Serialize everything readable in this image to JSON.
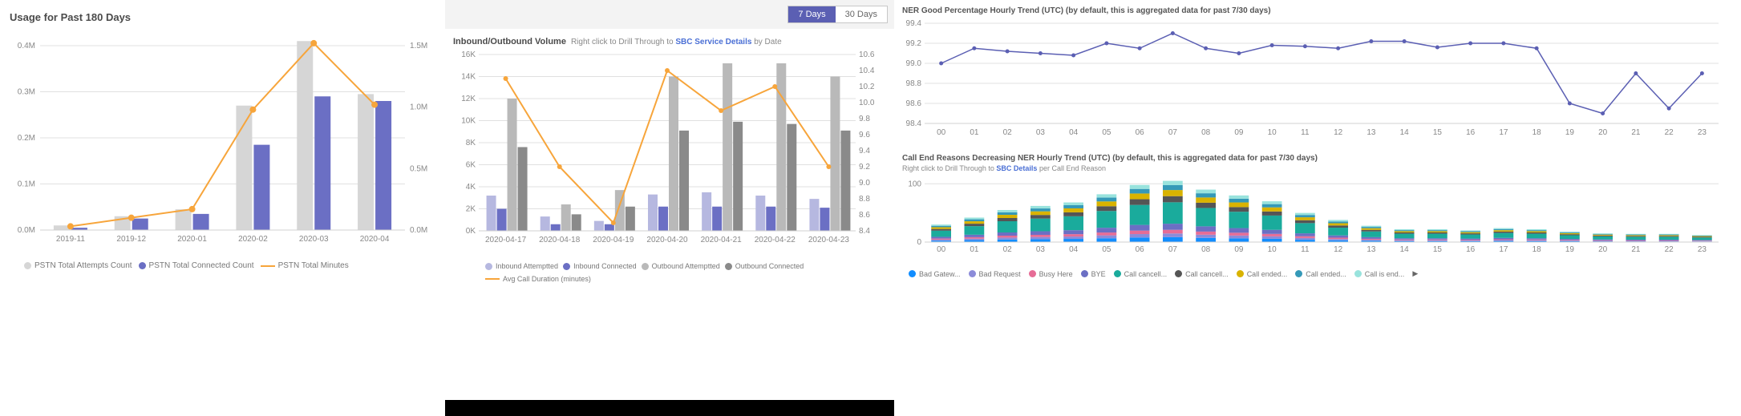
{
  "panel1": {
    "title": "Usage for Past 180 Days",
    "legend": {
      "attempts": "PSTN Total Attempts Count",
      "connected": "PSTN Total Connected Count",
      "minutes": "PSTN Total Minutes"
    },
    "y_left_labels": [
      "0.0M",
      "0.1M",
      "0.2M",
      "0.3M",
      "0.4M"
    ],
    "y_right_labels": [
      "0.0M",
      "0.5M",
      "1.0M",
      "1.5M"
    ],
    "categories": [
      "2019-11",
      "2019-12",
      "2020-01",
      "2020-02",
      "2020-03",
      "2020-04"
    ]
  },
  "panel2": {
    "toggle": {
      "opt1": "7 Days",
      "opt2": "30 Days"
    },
    "title": "Inbound/Outbound Volume",
    "drill_pre": "Right click to Drill Through to",
    "drill_link": "SBC Service Details",
    "drill_post": "by Date",
    "y_left_labels": [
      "16K",
      "14K",
      "12K",
      "10K",
      "8K",
      "6K",
      "4K",
      "2K",
      "0K"
    ],
    "y_right_labels": [
      "10.6",
      "10.4",
      "10.2",
      "10.0",
      "9.8",
      "9.6",
      "9.4",
      "9.2",
      "9.0",
      "8.8",
      "8.6",
      "8.4"
    ],
    "categories": [
      "2020-04-17",
      "2020-04-18",
      "2020-04-19",
      "2020-04-20",
      "2020-04-21",
      "2020-04-22",
      "2020-04-23"
    ],
    "legend": {
      "ia": "Inbound Attemptted",
      "ic": "Inbound Connected",
      "oa": "Outbound Attemptted",
      "oc": "Outbound Connected",
      "avg": "Avg Call Duration (minutes)"
    }
  },
  "panel3a": {
    "title": "NER Good Percentage Hourly Trend (UTC) (by default, this is aggregated data for past 7/30 days)",
    "y_labels": [
      "99.4",
      "99.2",
      "99.0",
      "98.8",
      "98.6",
      "98.4"
    ],
    "x_labels": [
      "00",
      "01",
      "02",
      "03",
      "04",
      "05",
      "06",
      "07",
      "08",
      "09",
      "10",
      "11",
      "12",
      "13",
      "14",
      "15",
      "16",
      "17",
      "18",
      "19",
      "20",
      "21",
      "22",
      "23"
    ]
  },
  "panel3b": {
    "title": "Call End Reasons Decreasing NER Hourly Trend (UTC) (by default, this is aggregated data for past 7/30 days)",
    "drill_pre": "Right click to Drill Through to",
    "drill_link": "SBC Details",
    "drill_post": "per Call End Reason",
    "y_labels": [
      "100",
      "0"
    ],
    "x_labels": [
      "00",
      "01",
      "02",
      "03",
      "04",
      "05",
      "06",
      "07",
      "08",
      "09",
      "10",
      "11",
      "12",
      "13",
      "14",
      "15",
      "16",
      "17",
      "18",
      "19",
      "20",
      "21",
      "22",
      "23"
    ],
    "legend": {
      "l1": "Bad Gatew...",
      "l2": "Bad Request",
      "l3": "Busy Here",
      "l4": "BYE",
      "l5": "Call cancell...",
      "l6": "Call cancell...",
      "l7": "Call ended...",
      "l8": "Call ended...",
      "l9": "Call is end..."
    }
  },
  "chart_data": [
    {
      "id": "usage_180_days",
      "type": "bar+line",
      "title": "Usage for Past 180 Days",
      "categories": [
        "2019-11",
        "2019-12",
        "2020-01",
        "2020-02",
        "2020-03",
        "2020-04"
      ],
      "series": [
        {
          "name": "PSTN Total Attempts Count",
          "axis": "left",
          "type": "bar",
          "values": [
            10000,
            30000,
            45000,
            270000,
            410000,
            295000
          ]
        },
        {
          "name": "PSTN Total Connected Count",
          "axis": "left",
          "type": "bar",
          "values": [
            5000,
            25000,
            35000,
            185000,
            290000,
            280000
          ]
        },
        {
          "name": "PSTN Total Minutes",
          "axis": "right",
          "type": "line",
          "values": [
            30000,
            100000,
            170000,
            980000,
            1520000,
            1020000
          ]
        }
      ],
      "y_left": {
        "min": 0,
        "max": 400000,
        "label": ""
      },
      "y_right": {
        "min": 0,
        "max": 1500000,
        "label": ""
      }
    },
    {
      "id": "inbound_outbound_volume",
      "type": "bar+line",
      "title": "Inbound/Outbound Volume",
      "categories": [
        "2020-04-17",
        "2020-04-18",
        "2020-04-19",
        "2020-04-20",
        "2020-04-21",
        "2020-04-22",
        "2020-04-23"
      ],
      "series": [
        {
          "name": "Inbound Attemptted",
          "axis": "left",
          "type": "bar",
          "values": [
            3200,
            1300,
            900,
            3300,
            3500,
            3200,
            2900
          ]
        },
        {
          "name": "Inbound Connected",
          "axis": "left",
          "type": "bar",
          "values": [
            2000,
            600,
            600,
            2200,
            2200,
            2200,
            2100
          ]
        },
        {
          "name": "Outbound Attemptted",
          "axis": "left",
          "type": "bar",
          "values": [
            12000,
            2400,
            3700,
            14000,
            15200,
            15200,
            14000
          ]
        },
        {
          "name": "Outbound Connected",
          "axis": "left",
          "type": "bar",
          "values": [
            7600,
            1500,
            2200,
            9100,
            9900,
            9700,
            9100
          ]
        },
        {
          "name": "Avg Call Duration (minutes)",
          "axis": "right",
          "type": "line",
          "values": [
            10.3,
            9.2,
            8.5,
            10.4,
            9.9,
            10.2,
            9.2
          ]
        }
      ],
      "y_left": {
        "min": 0,
        "max": 16000
      },
      "y_right": {
        "min": 8.4,
        "max": 10.6
      }
    },
    {
      "id": "ner_good_pct_hourly",
      "type": "line",
      "title": "NER Good Percentage Hourly Trend (UTC)",
      "x": [
        "00",
        "01",
        "02",
        "03",
        "04",
        "05",
        "06",
        "07",
        "08",
        "09",
        "10",
        "11",
        "12",
        "13",
        "14",
        "15",
        "16",
        "17",
        "18",
        "19",
        "20",
        "21",
        "22",
        "23"
      ],
      "series": [
        {
          "name": "NER Good %",
          "values": [
            99.0,
            99.15,
            99.12,
            99.1,
            99.08,
            99.2,
            99.15,
            99.3,
            99.15,
            99.1,
            99.18,
            99.17,
            99.15,
            99.22,
            99.22,
            99.16,
            99.2,
            99.2,
            99.15,
            98.6,
            98.5,
            98.9,
            98.55,
            98.9
          ]
        }
      ],
      "ylim": [
        98.4,
        99.4
      ]
    },
    {
      "id": "call_end_reasons_hourly",
      "type": "stacked-bar",
      "title": "Call End Reasons Decreasing NER Hourly Trend (UTC)",
      "x": [
        "00",
        "01",
        "02",
        "03",
        "04",
        "05",
        "06",
        "07",
        "08",
        "09",
        "10",
        "11",
        "12",
        "13",
        "14",
        "15",
        "16",
        "17",
        "18",
        "19",
        "20",
        "21",
        "22",
        "23"
      ],
      "stack_totals": [
        30,
        42,
        55,
        62,
        68,
        82,
        98,
        105,
        90,
        80,
        70,
        50,
        38,
        28,
        22,
        22,
        20,
        24,
        22,
        18,
        15,
        14,
        14,
        12
      ],
      "reasons": [
        "Bad Gateway",
        "Bad Request",
        "Busy Here",
        "BYE",
        "Call cancelled A",
        "Call cancelled B",
        "Call ended A",
        "Call ended B",
        "Call is ended"
      ],
      "ylim": [
        0,
        110
      ]
    }
  ]
}
